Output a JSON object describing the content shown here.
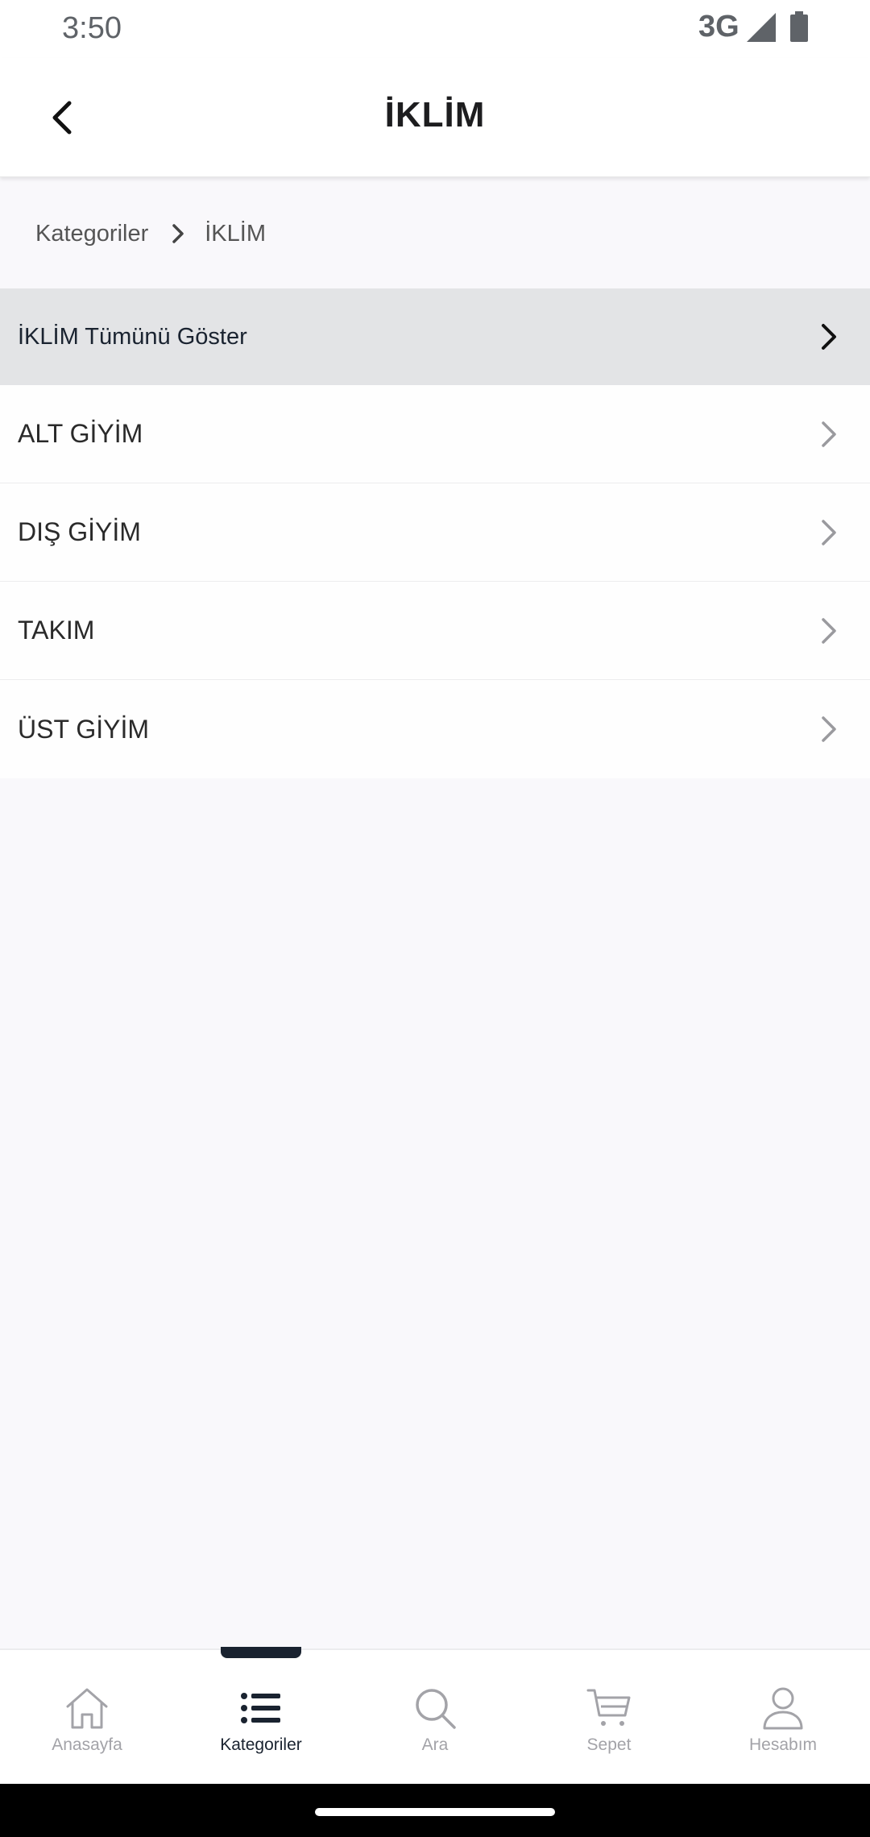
{
  "status_bar": {
    "time": "3:50",
    "network": "3G"
  },
  "header": {
    "title": "İKLİM"
  },
  "breadcrumb": {
    "root": "Kategoriler",
    "current": "İKLİM"
  },
  "category_list": {
    "show_all_label": "İKLİM Tümünü Göster",
    "items": [
      {
        "label": "ALT GİYİM"
      },
      {
        "label": "DIŞ GİYİM"
      },
      {
        "label": "TAKIM"
      },
      {
        "label": "ÜST GİYİM"
      }
    ]
  },
  "bottom_nav": {
    "items": [
      {
        "label": "Anasayfa",
        "icon": "home-icon"
      },
      {
        "label": "Kategoriler",
        "icon": "list-icon",
        "active": true
      },
      {
        "label": "Ara",
        "icon": "search-icon"
      },
      {
        "label": "Sepet",
        "icon": "cart-icon"
      },
      {
        "label": "Hesabım",
        "icon": "user-icon"
      }
    ]
  },
  "colors": {
    "accent": "#1a2330",
    "inactive": "#a3a3a8",
    "background": "#f9f8fb",
    "highlight_row": "#e3e4e6"
  }
}
